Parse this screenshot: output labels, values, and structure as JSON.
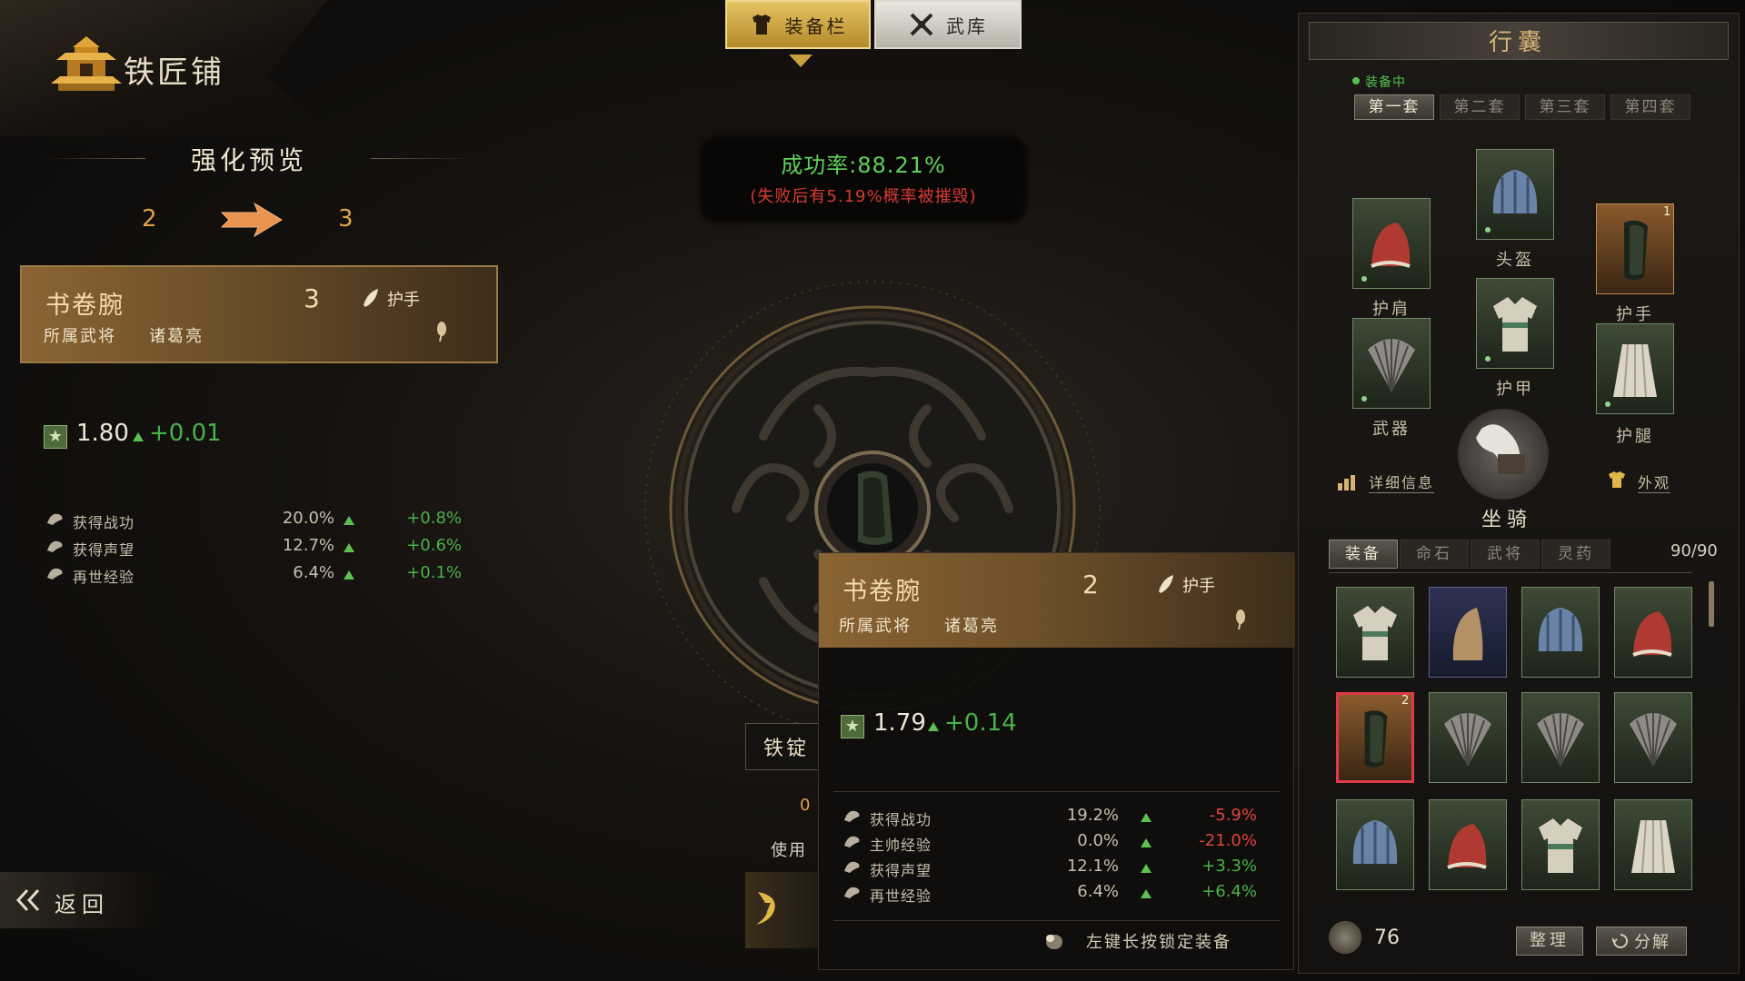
{
  "header": {
    "title": "铁匠铺"
  },
  "top_tabs": [
    {
      "label": "装备栏",
      "active": true
    },
    {
      "label": "武库",
      "active": false
    }
  ],
  "preview": {
    "title": "强化预览",
    "level_from": "2",
    "level_to": "3",
    "card": {
      "name": "书卷腕",
      "level": "3",
      "slot": "护手",
      "owner_label": "所属武将",
      "owner": "诸葛亮"
    },
    "rating": {
      "value": "1.80",
      "diff": "+0.01"
    },
    "attrs": [
      {
        "name": "获得战功",
        "value": "20.0%",
        "diff": "+0.8%"
      },
      {
        "name": "获得声望",
        "value": "12.7%",
        "diff": "+0.6%"
      },
      {
        "name": "再世经验",
        "value": "6.4%",
        "diff": "+0.1%"
      }
    ]
  },
  "center": {
    "success": "成功率:88.21%",
    "fail_note": "(失败后有5.19%概率被摧毁)",
    "material_label": "铁锭",
    "material_count": "0",
    "use_label": "使用"
  },
  "back": {
    "label": "返回"
  },
  "tooltip": {
    "name": "书卷腕",
    "level": "2",
    "slot": "护手",
    "owner_label": "所属武将",
    "owner": "诸葛亮",
    "rating": {
      "value": "1.79",
      "diff": "+0.14"
    },
    "attrs": [
      {
        "name": "获得战功",
        "value": "19.2%",
        "diff": "-5.9%",
        "sign": "neg"
      },
      {
        "name": "主帅经验",
        "value": "0.0%",
        "diff": "-21.0%",
        "sign": "neg"
      },
      {
        "name": "获得声望",
        "value": "12.1%",
        "diff": "+3.3%",
        "sign": "pos"
      },
      {
        "name": "再世经验",
        "value": "6.4%",
        "diff": "+6.4%",
        "sign": "pos"
      }
    ],
    "lock_hint": "左键长按锁定装备"
  },
  "right_panel": {
    "title": "行囊",
    "equipped_label": "装备中",
    "sets": [
      "第一套",
      "第二套",
      "第三套",
      "第四套"
    ],
    "slots": {
      "helmet": "头盔",
      "shoulder": "护肩",
      "hand": "护手",
      "armor": "护甲",
      "weapon": "武器",
      "legs": "护腿",
      "mount": "坐骑"
    },
    "hand_badge": "1",
    "detail_label": "详细信息",
    "appearance_label": "外观",
    "inv_tabs": [
      "装备",
      "命石",
      "武将",
      "灵药"
    ],
    "inv_count": "90/90",
    "grid_badge": "2",
    "coins": "76",
    "sort_label": "整理",
    "decompose_label": "分解"
  },
  "colors": {
    "accent_gold": "#d4b373",
    "success_green": "#5ed15b",
    "fail_red": "#d83b34",
    "level_orange": "#e0a24a"
  }
}
